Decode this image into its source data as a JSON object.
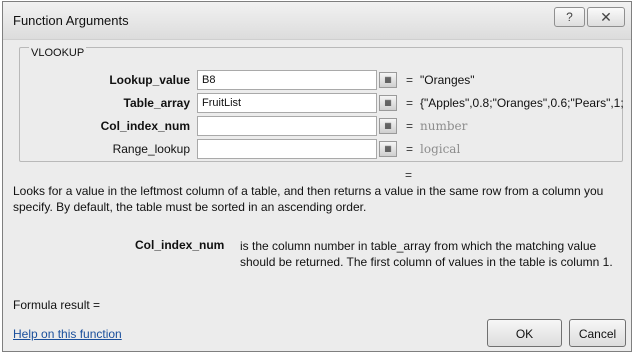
{
  "dialog": {
    "title": "Function Arguments",
    "help_button": "?",
    "close_button": "✕"
  },
  "function": {
    "name": "VLOOKUP",
    "result_equals": "="
  },
  "arguments": [
    {
      "label": "Lookup_value",
      "bold": true,
      "value": "B8",
      "equals": "=",
      "result": "\"Oranges\"",
      "result_gray": false
    },
    {
      "label": "Table_array",
      "bold": true,
      "value": "FruitList",
      "equals": "=",
      "result": "{\"Apples\",0.8;\"Oranges\",0.6;\"Pears\",1;",
      "result_gray": false
    },
    {
      "label": "Col_index_num",
      "bold": true,
      "value": "",
      "equals": "=",
      "result": "number",
      "result_gray": true
    },
    {
      "label": "Range_lookup",
      "bold": false,
      "value": "",
      "equals": "=",
      "result": "logical",
      "result_gray": true
    }
  ],
  "description": "Looks for a value in the leftmost column of a table, and then returns a value in the same row from a column you specify. By default, the table must be sorted in an ascending order.",
  "arg_help": {
    "name": "Col_index_num",
    "text": "is the column number in table_array from which the matching value should be returned. The first column of values in the table is column 1."
  },
  "formula_result": "Formula result =",
  "help_link": "Help on this function",
  "buttons": {
    "ok": "OK",
    "cancel": "Cancel"
  },
  "icons": {
    "ref_button": "collapse-dialog-icon"
  }
}
